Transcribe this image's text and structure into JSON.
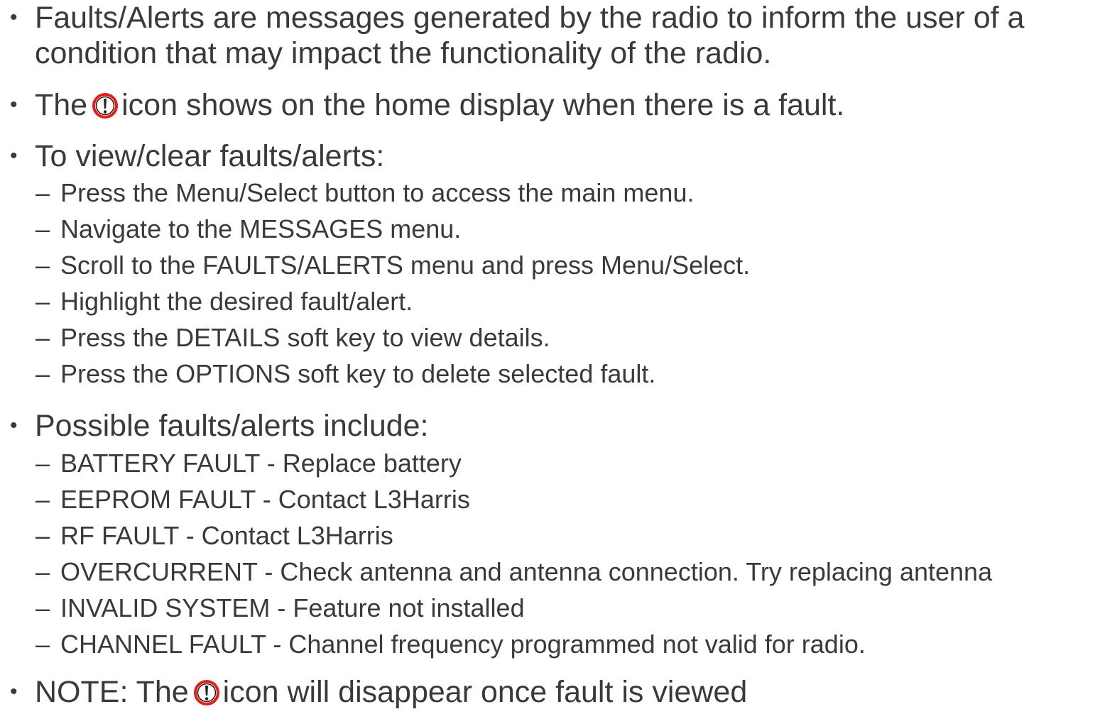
{
  "bullets": {
    "b1_line1": "Faults/Alerts are messages generated by the radio to inform the user of a",
    "b1_line2": "condition that may impact the functionality of the radio.",
    "b2_pre": "The",
    "b2_post": "icon shows on the home display when there is a fault.",
    "b3": "To view/clear faults/alerts:",
    "b4": "Possible faults/alerts include:",
    "b5_pre": "NOTE: The",
    "b5_post": "icon will disappear once fault is viewed"
  },
  "steps": [
    "Press the Menu/Select button to access the main menu.",
    "Navigate to the MESSAGES menu.",
    "Scroll to the FAULTS/ALERTS menu and press Menu/Select.",
    "Highlight the desired fault/alert.",
    "Press the DETAILS soft key to view details.",
    "Press the OPTIONS soft key to delete selected fault."
  ],
  "faults": [
    "BATTERY FAULT - Replace battery",
    "EEPROM FAULT - Contact L3Harris",
    "RF FAULT - Contact L3Harris",
    "OVERCURRENT - Check antenna and antenna connection. Try replacing antenna",
    "INVALID SYSTEM - Feature not installed",
    "CHANNEL FAULT - Channel frequency programmed not valid for radio."
  ],
  "symbols": {
    "bullet": "•",
    "dash": "–"
  },
  "icons": {
    "fault": "fault-exclamation-icon"
  },
  "colors": {
    "text": "#3a3a3a",
    "icon_ring": "#e0201b"
  }
}
